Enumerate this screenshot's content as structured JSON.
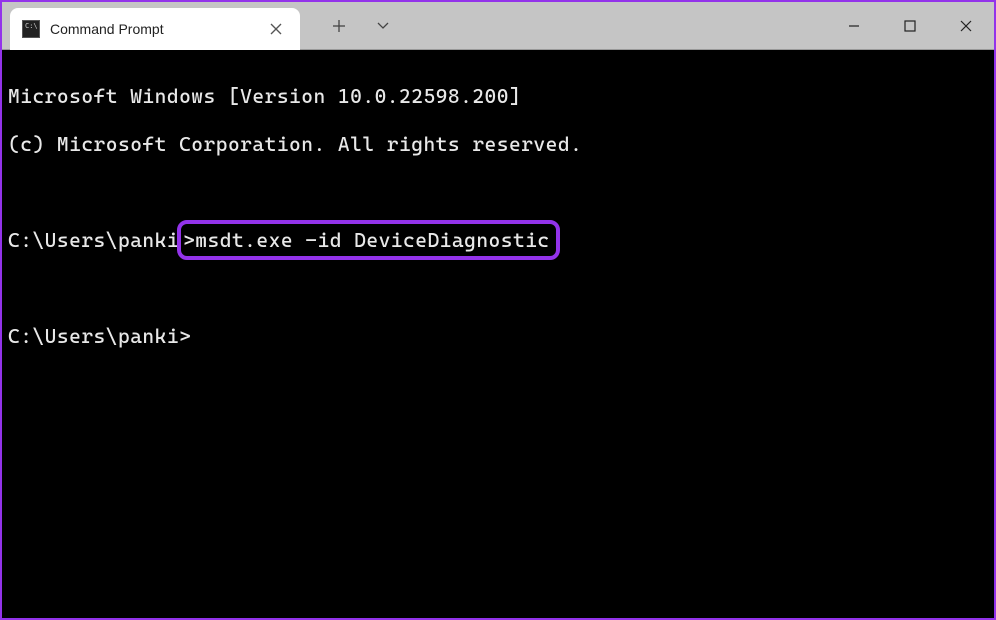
{
  "titlebar": {
    "tab": {
      "title": "Command Prompt"
    }
  },
  "terminal": {
    "line1": "Microsoft Windows [Version 10.0.22598.200]",
    "line2": "(c) Microsoft Corporation. All rights reserved.",
    "blank1": "",
    "prompt1_prefix": "C:\\Users\\panki",
    "prompt1_gt": ">",
    "command1": "msdt.exe -id DeviceDiagnostic",
    "blank2": "",
    "prompt2": "C:\\Users\\panki>"
  },
  "annotation": {
    "highlight_color": "#9333ea"
  }
}
